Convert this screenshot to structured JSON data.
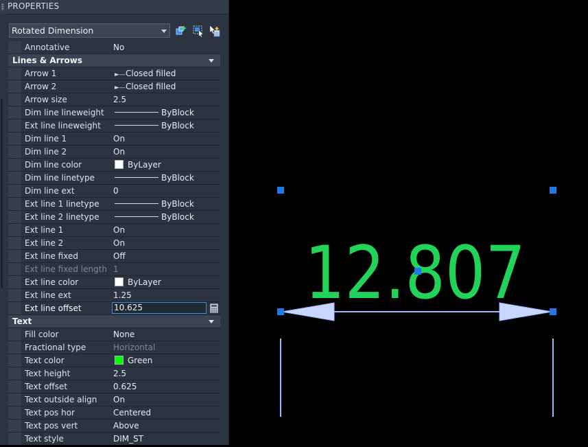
{
  "panel": {
    "title": "PROPERTIES",
    "object_type": "Rotated Dimension",
    "toolbar_icons": [
      "quick-select-icon",
      "select-objects-icon",
      "toggle-pickadd-icon"
    ]
  },
  "general": [
    {
      "label": "Annotative",
      "value": "No"
    }
  ],
  "lines_arrows": {
    "title": "Lines & Arrows",
    "rows": [
      {
        "label": "Arrow 1",
        "value": "Closed filled"
      },
      {
        "label": "Arrow 2",
        "value": "Closed filled"
      },
      {
        "label": "Arrow size",
        "value": "2.5"
      },
      {
        "label": "Dim line lineweight",
        "value": "ByBlock"
      },
      {
        "label": "Ext line lineweight",
        "value": "ByBlock"
      },
      {
        "label": "Dim line 1",
        "value": "On"
      },
      {
        "label": "Dim line 2",
        "value": "On"
      },
      {
        "label": "Dim line color",
        "value": "ByLayer"
      },
      {
        "label": "Dim line linetype",
        "value": "ByBlock"
      },
      {
        "label": "Dim line ext",
        "value": "0"
      },
      {
        "label": "Ext line 1 linetype",
        "value": "ByBlock"
      },
      {
        "label": "Ext line 2 linetype",
        "value": "ByBlock"
      },
      {
        "label": "Ext line 1",
        "value": "On"
      },
      {
        "label": "Ext line 2",
        "value": "On"
      },
      {
        "label": "Ext line fixed",
        "value": "Off"
      },
      {
        "label": "Ext line fixed length",
        "value": "1"
      },
      {
        "label": "Ext line color",
        "value": "ByLayer"
      },
      {
        "label": "Ext line ext",
        "value": "1.25"
      },
      {
        "label": "Ext line offset",
        "value": "10.625"
      }
    ]
  },
  "text": {
    "title": "Text",
    "rows": [
      {
        "label": "Fill color",
        "value": "None"
      },
      {
        "label": "Fractional type",
        "value": "Horizontal"
      },
      {
        "label": "Text color",
        "value": "Green"
      },
      {
        "label": "Text height",
        "value": "2.5"
      },
      {
        "label": "Text offset",
        "value": "0.625"
      },
      {
        "label": "Text outside align",
        "value": "On"
      },
      {
        "label": "Text pos hor",
        "value": "Centered"
      },
      {
        "label": "Text pos vert",
        "value": "Above"
      },
      {
        "label": "Text style",
        "value": "DIM_ST"
      }
    ]
  },
  "drawing": {
    "dimension_text": "12.807",
    "text_color": "#22d35a",
    "line_color": "#9db8ff",
    "grip_color": "#1e78e6"
  },
  "colors": {
    "white_swatch": "#ffffff",
    "green_swatch": "#00ff00",
    "accent": "#3d8be0"
  }
}
